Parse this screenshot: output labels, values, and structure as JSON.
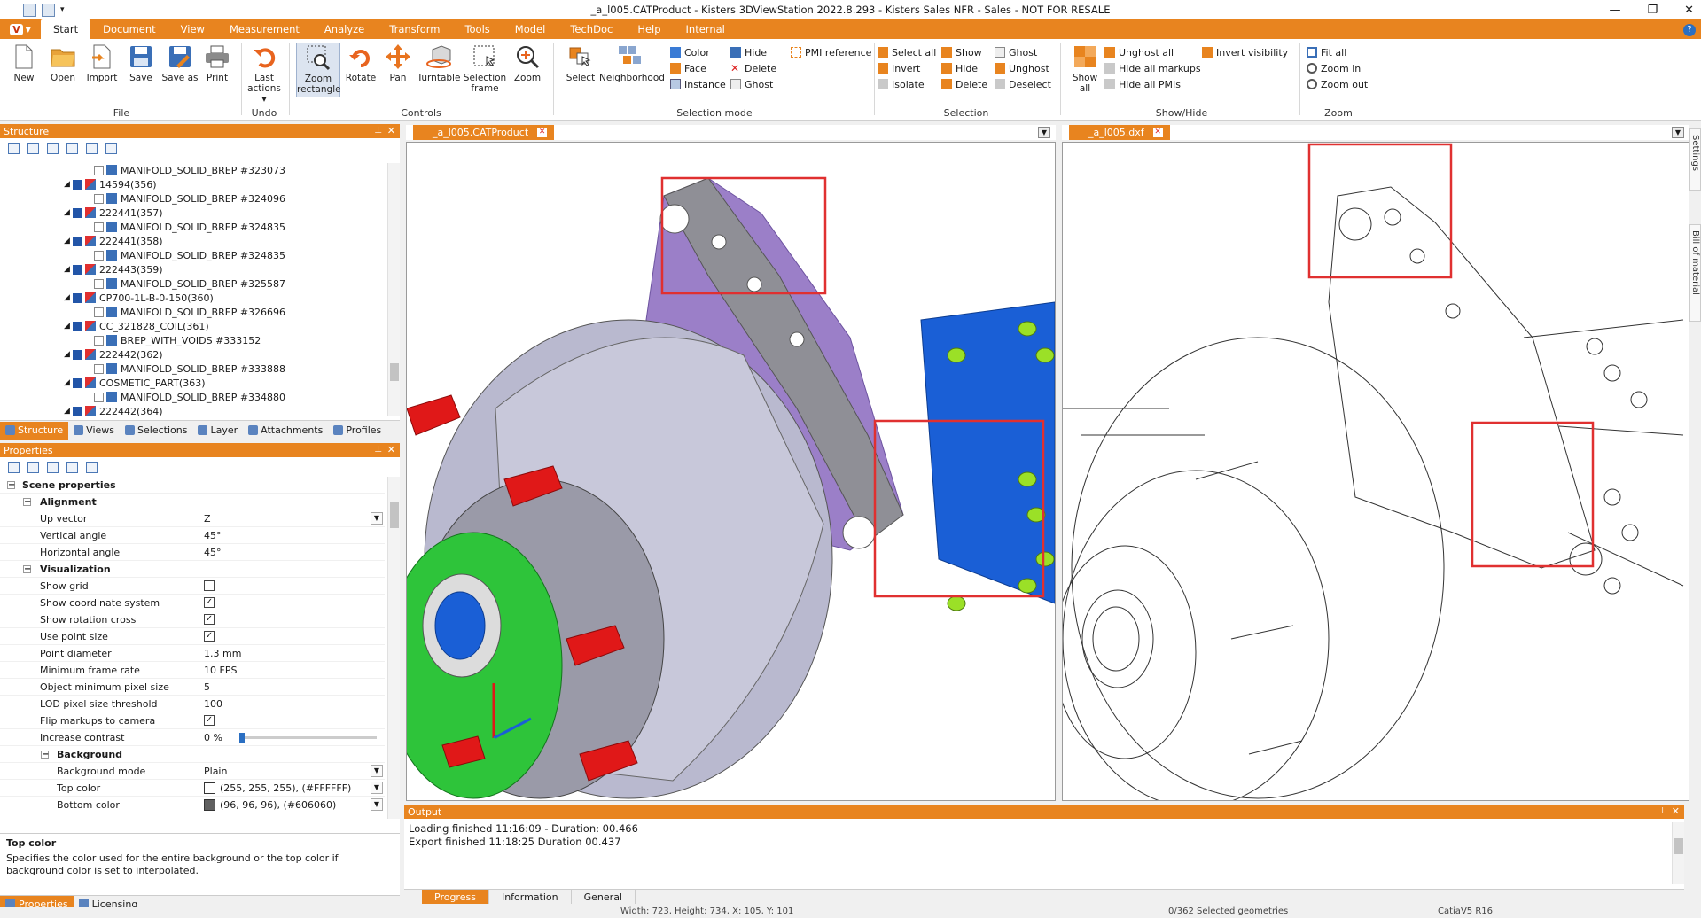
{
  "window": {
    "title": "_a_l005.CATProduct - Kisters 3DViewStation 2022.8.293 - Kisters Sales NFR - Sales - NOT FOR RESALE"
  },
  "ribbon": {
    "app_button": "V",
    "tabs": [
      "Start",
      "Document",
      "View",
      "Measurement",
      "Analyze",
      "Transform",
      "Tools",
      "Model",
      "TechDoc",
      "Help",
      "Internal"
    ],
    "active_tab": "Start",
    "groups": {
      "file": {
        "label": "File",
        "buttons": [
          "New",
          "Open",
          "Import",
          "Save",
          "Save as",
          "Print"
        ]
      },
      "undo": {
        "label": "Undo",
        "buttons": [
          "Last actions"
        ]
      },
      "controls": {
        "label": "Controls",
        "buttons": [
          "Zoom rectangle",
          "Rotate",
          "Pan",
          "Turntable",
          "Selection frame",
          "Zoom"
        ]
      },
      "selection_mode": {
        "label": "Selection mode",
        "big": [
          "Select",
          "Neighborhood"
        ],
        "small": [
          "Color",
          "Face",
          "Instance",
          "Hide",
          "Delete",
          "Ghost",
          "PMI reference"
        ]
      },
      "selection": {
        "label": "Selection",
        "small": [
          "Select all",
          "Invert",
          "Isolate",
          "Show",
          "Hide",
          "Delete",
          "Ghost",
          "Unghost",
          "Deselect"
        ]
      },
      "showhide": {
        "label": "Show/Hide",
        "big": [
          "Show all"
        ],
        "small": [
          "Unghost all",
          "Hide all markups",
          "Hide all PMIs",
          "Invert visibility"
        ]
      },
      "zoom": {
        "label": "Zoom",
        "small": [
          "Fit all",
          "Zoom in",
          "Zoom out"
        ]
      }
    }
  },
  "structure": {
    "title": "Structure",
    "rows": [
      {
        "label": "MANIFOLD_SOLID_BREP #323073",
        "level": 2
      },
      {
        "label": "14594(356)",
        "level": 1
      },
      {
        "label": "MANIFOLD_SOLID_BREP #324096",
        "level": 2
      },
      {
        "label": "222441(357)",
        "level": 1
      },
      {
        "label": "MANIFOLD_SOLID_BREP #324835",
        "level": 2
      },
      {
        "label": "222441(358)",
        "level": 1
      },
      {
        "label": "MANIFOLD_SOLID_BREP #324835",
        "level": 2
      },
      {
        "label": "222443(359)",
        "level": 1
      },
      {
        "label": "MANIFOLD_SOLID_BREP #325587",
        "level": 2
      },
      {
        "label": "CP700-1L-B-0-150(360)",
        "level": 1
      },
      {
        "label": "MANIFOLD_SOLID_BREP #326696",
        "level": 2
      },
      {
        "label": "CC_321828_COIL(361)",
        "level": 1
      },
      {
        "label": "BREP_WITH_VOIDS #333152",
        "level": 2
      },
      {
        "label": "222442(362)",
        "level": 1
      },
      {
        "label": "MANIFOLD_SOLID_BREP #333888",
        "level": 2
      },
      {
        "label": "COSMETIC_PART(363)",
        "level": 1
      },
      {
        "label": "MANIFOLD_SOLID_BREP #334880",
        "level": 2
      },
      {
        "label": "222442(364)",
        "level": 1
      }
    ],
    "tabs": [
      "Structure",
      "Views",
      "Selections",
      "Layer",
      "Attachments",
      "Profiles"
    ]
  },
  "properties": {
    "title": "Properties",
    "scene_properties": "Scene properties",
    "alignment": "Alignment",
    "up_vector": {
      "label": "Up vector",
      "value": "Z"
    },
    "vertical_angle": {
      "label": "Vertical angle",
      "value": "45°"
    },
    "horizontal_angle": {
      "label": "Horizontal angle",
      "value": "45°"
    },
    "visualization": "Visualization",
    "show_grid": {
      "label": "Show grid",
      "checked": false
    },
    "show_coord": {
      "label": "Show coordinate system",
      "checked": true
    },
    "show_rot": {
      "label": "Show rotation cross",
      "checked": true
    },
    "use_point": {
      "label": "Use point size",
      "checked": true
    },
    "point_diameter": {
      "label": "Point diameter",
      "value": "1.3 mm"
    },
    "min_frame": {
      "label": "Minimum frame rate",
      "value": "10 FPS"
    },
    "obj_min_px": {
      "label": "Object minimum pixel size",
      "value": "5"
    },
    "lod": {
      "label": "LOD pixel size threshold",
      "value": "100"
    },
    "flip": {
      "label": "Flip markups to camera",
      "checked": true
    },
    "contrast": {
      "label": "Increase contrast",
      "value": "0 %"
    },
    "background": "Background",
    "bg_mode": {
      "label": "Background mode",
      "value": "Plain"
    },
    "top_color": {
      "label": "Top color",
      "value": "(255, 255, 255), (#FFFFFF)",
      "hex": "#FFFFFF"
    },
    "bottom_color": {
      "label": "Bottom color",
      "value": "(96, 96, 96), (#606060)",
      "hex": "#606060"
    },
    "desc_title": "Top color",
    "desc_text": "Specifies the color used for the entire background or the top color if background color is set to interpolated.",
    "tabs": [
      "Properties",
      "Licensing"
    ]
  },
  "viewports": {
    "left_tab": "_a_l005.CATProduct",
    "right_tab": "_a_l005.dxf"
  },
  "side_tabs": [
    "Settings",
    "Bill of material"
  ],
  "output": {
    "title": "Output",
    "lines": [
      "Loading finished 11:16:09 - Duration: 00.466",
      "Export finished 11:18:25 Duration 00.437"
    ],
    "tabs": [
      "Progress",
      "Information",
      "General"
    ]
  },
  "status": {
    "dims": "Width: 723, Height: 734, X: 105, Y: 101",
    "selected": "0/362 Selected geometries",
    "format": "CatiaV5 R16"
  },
  "colors": {
    "accent": "#e8841f",
    "highlight_box": "#e03030",
    "purple": "#9b7fc8",
    "green": "#2ec43a",
    "blue": "#1a5fd6",
    "red": "#e01818",
    "lime": "#9be027"
  }
}
